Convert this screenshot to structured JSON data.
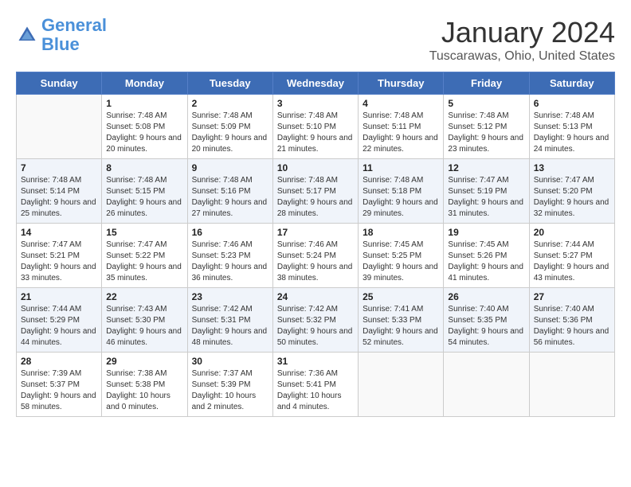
{
  "header": {
    "logo_line1": "General",
    "logo_line2": "Blue",
    "month_title": "January 2024",
    "location": "Tuscarawas, Ohio, United States"
  },
  "days_of_week": [
    "Sunday",
    "Monday",
    "Tuesday",
    "Wednesday",
    "Thursday",
    "Friday",
    "Saturday"
  ],
  "weeks": [
    [
      {
        "day": "",
        "sunrise": "",
        "sunset": "",
        "daylight": ""
      },
      {
        "day": "1",
        "sunrise": "Sunrise: 7:48 AM",
        "sunset": "Sunset: 5:08 PM",
        "daylight": "Daylight: 9 hours and 20 minutes."
      },
      {
        "day": "2",
        "sunrise": "Sunrise: 7:48 AM",
        "sunset": "Sunset: 5:09 PM",
        "daylight": "Daylight: 9 hours and 20 minutes."
      },
      {
        "day": "3",
        "sunrise": "Sunrise: 7:48 AM",
        "sunset": "Sunset: 5:10 PM",
        "daylight": "Daylight: 9 hours and 21 minutes."
      },
      {
        "day": "4",
        "sunrise": "Sunrise: 7:48 AM",
        "sunset": "Sunset: 5:11 PM",
        "daylight": "Daylight: 9 hours and 22 minutes."
      },
      {
        "day": "5",
        "sunrise": "Sunrise: 7:48 AM",
        "sunset": "Sunset: 5:12 PM",
        "daylight": "Daylight: 9 hours and 23 minutes."
      },
      {
        "day": "6",
        "sunrise": "Sunrise: 7:48 AM",
        "sunset": "Sunset: 5:13 PM",
        "daylight": "Daylight: 9 hours and 24 minutes."
      }
    ],
    [
      {
        "day": "7",
        "sunrise": "Sunrise: 7:48 AM",
        "sunset": "Sunset: 5:14 PM",
        "daylight": "Daylight: 9 hours and 25 minutes."
      },
      {
        "day": "8",
        "sunrise": "Sunrise: 7:48 AM",
        "sunset": "Sunset: 5:15 PM",
        "daylight": "Daylight: 9 hours and 26 minutes."
      },
      {
        "day": "9",
        "sunrise": "Sunrise: 7:48 AM",
        "sunset": "Sunset: 5:16 PM",
        "daylight": "Daylight: 9 hours and 27 minutes."
      },
      {
        "day": "10",
        "sunrise": "Sunrise: 7:48 AM",
        "sunset": "Sunset: 5:17 PM",
        "daylight": "Daylight: 9 hours and 28 minutes."
      },
      {
        "day": "11",
        "sunrise": "Sunrise: 7:48 AM",
        "sunset": "Sunset: 5:18 PM",
        "daylight": "Daylight: 9 hours and 29 minutes."
      },
      {
        "day": "12",
        "sunrise": "Sunrise: 7:47 AM",
        "sunset": "Sunset: 5:19 PM",
        "daylight": "Daylight: 9 hours and 31 minutes."
      },
      {
        "day": "13",
        "sunrise": "Sunrise: 7:47 AM",
        "sunset": "Sunset: 5:20 PM",
        "daylight": "Daylight: 9 hours and 32 minutes."
      }
    ],
    [
      {
        "day": "14",
        "sunrise": "Sunrise: 7:47 AM",
        "sunset": "Sunset: 5:21 PM",
        "daylight": "Daylight: 9 hours and 33 minutes."
      },
      {
        "day": "15",
        "sunrise": "Sunrise: 7:47 AM",
        "sunset": "Sunset: 5:22 PM",
        "daylight": "Daylight: 9 hours and 35 minutes."
      },
      {
        "day": "16",
        "sunrise": "Sunrise: 7:46 AM",
        "sunset": "Sunset: 5:23 PM",
        "daylight": "Daylight: 9 hours and 36 minutes."
      },
      {
        "day": "17",
        "sunrise": "Sunrise: 7:46 AM",
        "sunset": "Sunset: 5:24 PM",
        "daylight": "Daylight: 9 hours and 38 minutes."
      },
      {
        "day": "18",
        "sunrise": "Sunrise: 7:45 AM",
        "sunset": "Sunset: 5:25 PM",
        "daylight": "Daylight: 9 hours and 39 minutes."
      },
      {
        "day": "19",
        "sunrise": "Sunrise: 7:45 AM",
        "sunset": "Sunset: 5:26 PM",
        "daylight": "Daylight: 9 hours and 41 minutes."
      },
      {
        "day": "20",
        "sunrise": "Sunrise: 7:44 AM",
        "sunset": "Sunset: 5:27 PM",
        "daylight": "Daylight: 9 hours and 43 minutes."
      }
    ],
    [
      {
        "day": "21",
        "sunrise": "Sunrise: 7:44 AM",
        "sunset": "Sunset: 5:29 PM",
        "daylight": "Daylight: 9 hours and 44 minutes."
      },
      {
        "day": "22",
        "sunrise": "Sunrise: 7:43 AM",
        "sunset": "Sunset: 5:30 PM",
        "daylight": "Daylight: 9 hours and 46 minutes."
      },
      {
        "day": "23",
        "sunrise": "Sunrise: 7:42 AM",
        "sunset": "Sunset: 5:31 PM",
        "daylight": "Daylight: 9 hours and 48 minutes."
      },
      {
        "day": "24",
        "sunrise": "Sunrise: 7:42 AM",
        "sunset": "Sunset: 5:32 PM",
        "daylight": "Daylight: 9 hours and 50 minutes."
      },
      {
        "day": "25",
        "sunrise": "Sunrise: 7:41 AM",
        "sunset": "Sunset: 5:33 PM",
        "daylight": "Daylight: 9 hours and 52 minutes."
      },
      {
        "day": "26",
        "sunrise": "Sunrise: 7:40 AM",
        "sunset": "Sunset: 5:35 PM",
        "daylight": "Daylight: 9 hours and 54 minutes."
      },
      {
        "day": "27",
        "sunrise": "Sunrise: 7:40 AM",
        "sunset": "Sunset: 5:36 PM",
        "daylight": "Daylight: 9 hours and 56 minutes."
      }
    ],
    [
      {
        "day": "28",
        "sunrise": "Sunrise: 7:39 AM",
        "sunset": "Sunset: 5:37 PM",
        "daylight": "Daylight: 9 hours and 58 minutes."
      },
      {
        "day": "29",
        "sunrise": "Sunrise: 7:38 AM",
        "sunset": "Sunset: 5:38 PM",
        "daylight": "Daylight: 10 hours and 0 minutes."
      },
      {
        "day": "30",
        "sunrise": "Sunrise: 7:37 AM",
        "sunset": "Sunset: 5:39 PM",
        "daylight": "Daylight: 10 hours and 2 minutes."
      },
      {
        "day": "31",
        "sunrise": "Sunrise: 7:36 AM",
        "sunset": "Sunset: 5:41 PM",
        "daylight": "Daylight: 10 hours and 4 minutes."
      },
      {
        "day": "",
        "sunrise": "",
        "sunset": "",
        "daylight": ""
      },
      {
        "day": "",
        "sunrise": "",
        "sunset": "",
        "daylight": ""
      },
      {
        "day": "",
        "sunrise": "",
        "sunset": "",
        "daylight": ""
      }
    ]
  ]
}
